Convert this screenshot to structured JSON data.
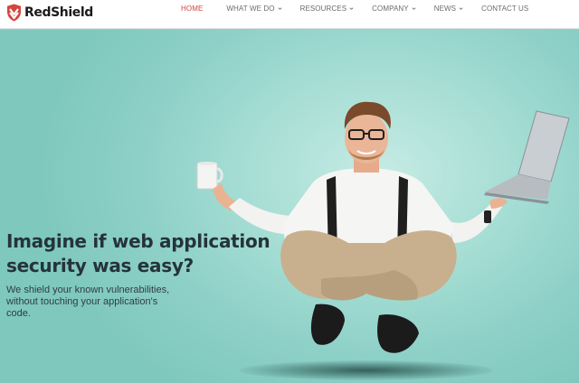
{
  "brand": {
    "name": "RedShield",
    "accent_color": "#d4453d",
    "logo_icon": "shield-icon"
  },
  "nav": {
    "items": [
      {
        "label": "HOME",
        "active": true,
        "has_dropdown": false
      },
      {
        "label": "WHAT WE DO",
        "active": false,
        "has_dropdown": true
      },
      {
        "label": "RESOURCES",
        "active": false,
        "has_dropdown": true
      },
      {
        "label": "COMPANY",
        "active": false,
        "has_dropdown": true
      },
      {
        "label": "NEWS",
        "active": false,
        "has_dropdown": true
      },
      {
        "label": "CONTACT US",
        "active": false,
        "has_dropdown": false
      }
    ],
    "dropdown_icon": "chevron-down-icon"
  },
  "hero": {
    "headline_line1": "Imagine if web application",
    "headline_line2": "security was easy?",
    "subcopy_line1": "We shield your known vulnerabilities,",
    "subcopy_line2": "without touching your application's",
    "subcopy_line3": "code.",
    "background_color": "#8fd2c9",
    "image": "levitating-man-with-mug-and-laptop"
  }
}
